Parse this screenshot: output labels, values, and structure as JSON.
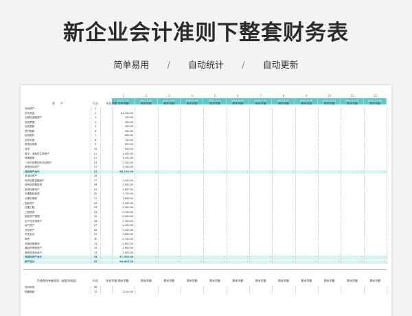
{
  "page": {
    "title": "新企业会计准则下整套财务表",
    "tags": [
      "简单易用",
      "自动统计",
      "自动更新"
    ],
    "separator": "/"
  },
  "colors": {
    "accent": "#5cc9cc",
    "highlight": "#d9f4f5",
    "number": "#d44"
  },
  "sheet": {
    "col_numbers": [
      "1",
      "2",
      "3",
      "4",
      "5",
      "6",
      "7",
      "8",
      "9",
      "10",
      "11",
      "12"
    ],
    "col_dates": [
      "2021.1.31",
      "2021.2.28",
      "2021.3.31",
      "2021.4.30",
      "2021.5.31",
      "2021.6.30",
      "2021.7.31",
      "2021.8.31",
      "2021.9.30",
      "2021.10.31",
      "2021.11.30",
      "2021.12.31"
    ],
    "header": {
      "asset": "资　　产",
      "row_no": "行次",
      "begin": "年初余额",
      "end": "期末余额"
    },
    "rows": [
      {
        "label": "流动资产：",
        "no": "1",
        "val": ""
      },
      {
        "label": "货币资金",
        "no": "2",
        "val": "61,100.00"
      },
      {
        "label": "交易性金融资产",
        "no": "3",
        "val": "200.00"
      },
      {
        "label": "应收票据",
        "no": "4",
        "val": "300.00"
      },
      {
        "label": "应收账款",
        "no": "5",
        "val": "400.00"
      },
      {
        "label": "预付账款",
        "no": "6",
        "val": "500.00"
      },
      {
        "label": "应收股利",
        "no": "7",
        "val": "600.00"
      },
      {
        "label": "应收利息",
        "no": "8",
        "val": "700.00"
      },
      {
        "label": "其他应收款",
        "no": "9",
        "val": "800.00"
      },
      {
        "label": "存货",
        "no": "10",
        "val": "900.00"
      },
      {
        "label": "其中：消耗性生物资产",
        "no": "11",
        "val": "1,000.00"
      },
      {
        "label": "待摊费用",
        "no": "12",
        "val": "1,100.00"
      },
      {
        "label": "一年内到期的非流动资产",
        "no": "13",
        "val": "1,200.00"
      },
      {
        "label": "其他流动资产",
        "no": "14",
        "val": "1,300.00"
      },
      {
        "label": "流动资产合计",
        "no": "15",
        "val": "68,100.00",
        "hl": true
      },
      {
        "label": "非流动资产：",
        "no": "16",
        "val": ""
      },
      {
        "label": "可供出售金融资产",
        "no": "17",
        "val": "1,400.00"
      },
      {
        "label": "持有至到期投资",
        "no": "18",
        "val": "1,500.00"
      },
      {
        "label": "投资性房地产",
        "no": "19",
        "val": "1,600.00"
      },
      {
        "label": "长期股权投资",
        "no": "20",
        "val": "1,700.00"
      },
      {
        "label": "长期应收款",
        "no": "21",
        "val": "1,800.00"
      },
      {
        "label": "固定资产",
        "no": "22",
        "val": "1,900.00"
      },
      {
        "label": "在建工程",
        "no": "23",
        "val": "2,000.00"
      },
      {
        "label": "工程物资",
        "no": "24",
        "val": "2,100.00"
      },
      {
        "label": "固定资产清理",
        "no": "25",
        "val": "2,200.00"
      },
      {
        "label": "生产性生物资产",
        "no": "26",
        "val": "2,300.00"
      },
      {
        "label": "油气资产",
        "no": "27",
        "val": "2,400.00"
      },
      {
        "label": "无形资产",
        "no": "28",
        "val": "2,500.00"
      },
      {
        "label": "开发支出",
        "no": "29",
        "val": "2,600.00"
      },
      {
        "label": "商誉",
        "no": "30",
        "val": "2,700.00"
      },
      {
        "label": "长期待摊费用",
        "no": "31",
        "val": "2,800.00"
      },
      {
        "label": "递延所得税资产",
        "no": "32",
        "val": "2,900.00"
      },
      {
        "label": "其他非流动资产",
        "no": "33",
        "val": "3,000.00"
      },
      {
        "label": "非流动资产合计",
        "no": "34",
        "val": "37,400.00",
        "hl": true
      },
      {
        "label": "资产总计",
        "no": "35",
        "val": "96,600.00",
        "hl": true
      }
    ],
    "dash": "-",
    "bottom_header": {
      "label": "负债和所有者权益（或股东权益）",
      "row_no": "行次",
      "begin": "年初余额",
      "end": "期末余额"
    },
    "bottom_rows": [
      {
        "label": "流动负债：",
        "no": "36",
        "val": ""
      },
      {
        "label": "短期借款",
        "no": "37",
        "val": "3,100.00"
      }
    ]
  }
}
